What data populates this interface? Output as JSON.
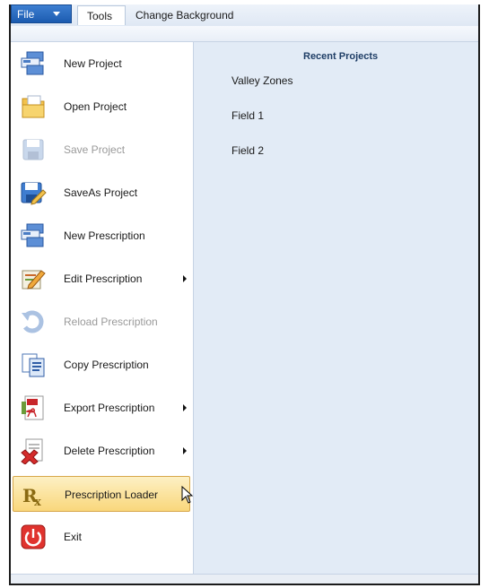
{
  "menubar": {
    "file_label": "File",
    "tools_label": "Tools",
    "change_background_label": "Change Background"
  },
  "menu": {
    "items": [
      {
        "label": "New Project",
        "icon": "new-project-icon",
        "enabled": true,
        "submenu": false
      },
      {
        "label": "Open Project",
        "icon": "open-folder-icon",
        "enabled": true,
        "submenu": false
      },
      {
        "label": "Save Project",
        "icon": "save-disk-icon",
        "enabled": false,
        "submenu": false
      },
      {
        "label": "SaveAs Project",
        "icon": "save-as-icon",
        "enabled": true,
        "submenu": false
      },
      {
        "label": "New Prescription",
        "icon": "new-prescription-icon",
        "enabled": true,
        "submenu": false
      },
      {
        "label": "Edit Prescription",
        "icon": "edit-pencil-icon",
        "enabled": true,
        "submenu": true
      },
      {
        "label": "Reload Prescription",
        "icon": "reload-arrow-icon",
        "enabled": false,
        "submenu": false
      },
      {
        "label": "Copy Prescription",
        "icon": "copy-documents-icon",
        "enabled": true,
        "submenu": false
      },
      {
        "label": "Export Prescription",
        "icon": "pdf-export-icon",
        "enabled": true,
        "submenu": true
      },
      {
        "label": "Delete Prescription",
        "icon": "delete-document-icon",
        "enabled": true,
        "submenu": true
      },
      {
        "label": "Prescription Loader",
        "icon": "rx-icon",
        "enabled": true,
        "submenu": false,
        "highlighted": true
      },
      {
        "label": "Exit",
        "icon": "power-icon",
        "enabled": true,
        "submenu": false
      }
    ]
  },
  "recent": {
    "title": "Recent Projects",
    "items": [
      "Valley Zones",
      "Field 1",
      "Field 2"
    ]
  },
  "colors": {
    "file_button": "#1c5bb0",
    "highlight": "#f9d77b",
    "panel": "#e2ebf6"
  }
}
